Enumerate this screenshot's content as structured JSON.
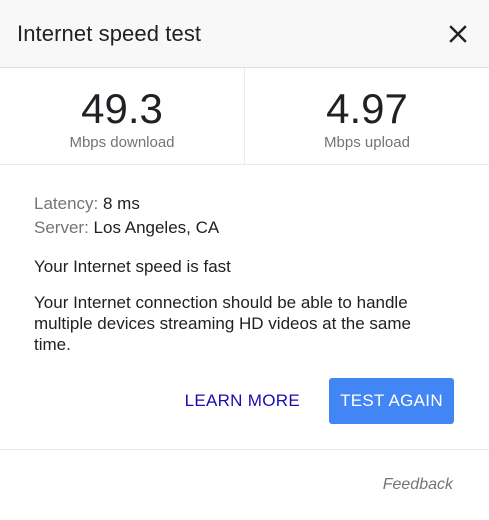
{
  "header": {
    "title": "Internet speed test",
    "close_icon": "close-icon"
  },
  "results": {
    "download": {
      "value": "49.3",
      "label": "Mbps download"
    },
    "upload": {
      "value": "4.97",
      "label": "Mbps upload"
    }
  },
  "details": {
    "latency_label": "Latency:",
    "latency_value": "8 ms",
    "server_label": "Server:",
    "server_value": "Los Angeles, CA"
  },
  "summary": "Your Internet speed is fast",
  "description": "Your Internet connection should be able to handle multiple devices streaming HD videos at the same time.",
  "actions": {
    "learn_more": "LEARN MORE",
    "test_again": "TEST AGAIN"
  },
  "footer": {
    "feedback": "Feedback"
  },
  "colors": {
    "accent": "#4285f4",
    "link": "#1a0dab",
    "muted": "#70757a"
  }
}
